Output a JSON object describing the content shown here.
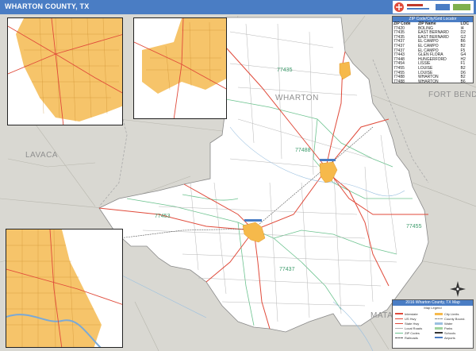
{
  "title": "WHARTON COUNTY, TX",
  "colors": {
    "title_bar": "#4a7dc4",
    "background": "#d9d8d2",
    "county": "#ffffff",
    "highway": "#e04a3a",
    "road": "#9a9a9a",
    "zip_boundary": "#6cc38f",
    "city_area": "#f6b94b",
    "water": "#9bc0e0"
  },
  "county_labels": {
    "lavaca": "LAVACA",
    "fort_bend": "FORT BEND",
    "wharton": "WHARTON",
    "matagorda": "MATA"
  },
  "zip_labels": [
    "77435",
    "77488",
    "77453",
    "77437",
    "77455"
  ],
  "zip_table": {
    "title": "ZIP Code/City/Grid Locator",
    "headers": [
      "ZIP Code",
      "ZIP Name",
      "LOC"
    ],
    "rows": [
      [
        "77420",
        "BOLING",
        "I4"
      ],
      [
        "77435",
        "EAST BERNARD",
        "D2"
      ],
      [
        "77435",
        "EAST BERNARD",
        "G2"
      ],
      [
        "77437",
        "EL CAMPO",
        "B6"
      ],
      [
        "77437",
        "EL CAMPO",
        "B2"
      ],
      [
        "77437",
        "EL CAMPO",
        "F5"
      ],
      [
        "77443",
        "GLEN FLORA",
        "G4"
      ],
      [
        "77448",
        "HUNGERFORD",
        "H2"
      ],
      [
        "77454",
        "LISSIE",
        "F1"
      ],
      [
        "77455",
        "LOUISE",
        "B2"
      ],
      [
        "77455",
        "LOUISE",
        "D6"
      ],
      [
        "77488",
        "WHARTON",
        "B2"
      ],
      [
        "77488",
        "WHARTON",
        "B6"
      ],
      [
        "77488",
        "WHARTON",
        "G4"
      ]
    ]
  },
  "legend": {
    "title": "2016 Wharton County, TX Map",
    "subtitle": "Map Legend",
    "left_items": [
      "Interstate",
      "US Hwy",
      "State Hwy",
      "Local Roads",
      "ZIP Codes",
      "Railroads"
    ],
    "right_items": [
      "City Limits",
      "County Bound.",
      "Water",
      "Parks",
      "Schools",
      "Airports"
    ]
  }
}
